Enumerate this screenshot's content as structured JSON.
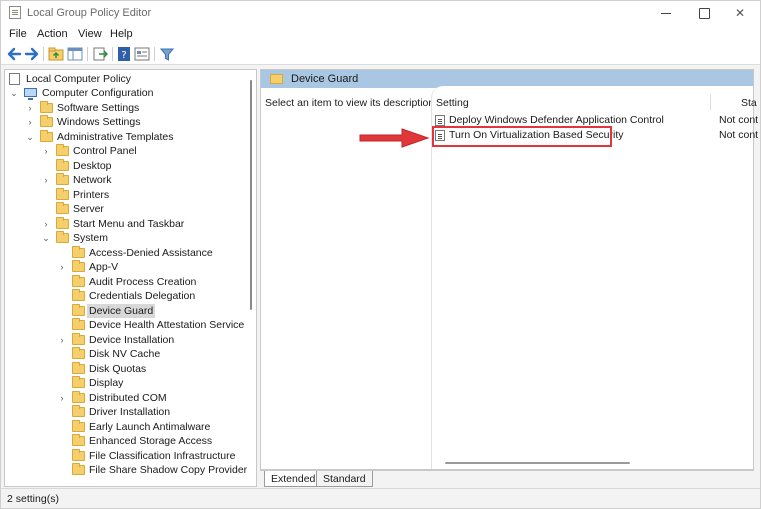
{
  "window": {
    "title": "Local Group Policy Editor"
  },
  "menu": [
    "File",
    "Action",
    "View",
    "Help"
  ],
  "toolbar": {
    "icons": [
      "back-arrow-icon",
      "forward-arrow-icon",
      "up-folder-icon",
      "show-hide-tree-icon",
      "export-list-icon",
      "help-icon",
      "properties-icon",
      "filter-icon"
    ]
  },
  "tree": {
    "root": "Local Computer Policy",
    "computer_config": "Computer Configuration",
    "software_settings": "Software Settings",
    "windows_settings": "Windows Settings",
    "admin_templates": "Administrative Templates",
    "control_panel": "Control Panel",
    "desktop": "Desktop",
    "network": "Network",
    "printers": "Printers",
    "server": "Server",
    "start_menu": "Start Menu and Taskbar",
    "system": "System",
    "system_children": [
      "Access-Denied Assistance",
      "App-V",
      "Audit Process Creation",
      "Credentials Delegation",
      "Device Guard",
      "Device Health Attestation Service",
      "Device Installation",
      "Disk NV Cache",
      "Disk Quotas",
      "Display",
      "Distributed COM",
      "Driver Installation",
      "Early Launch Antimalware",
      "Enhanced Storage Access",
      "File Classification Infrastructure",
      "File Share Shadow Copy Provider"
    ],
    "selected": "Device Guard"
  },
  "right_pane": {
    "header_title": "Device Guard",
    "description": "Select an item to view its description.",
    "columns": {
      "setting": "Setting",
      "state": "Sta"
    },
    "rows": [
      {
        "name": "Deploy Windows Defender Application Control",
        "state": "Not cont"
      },
      {
        "name": "Turn On Virtualization Based Security",
        "state": "Not cont"
      }
    ],
    "highlight_color": "#e0383a"
  },
  "tabs": [
    "Extended",
    "Standard"
  ],
  "status": "2 setting(s)"
}
